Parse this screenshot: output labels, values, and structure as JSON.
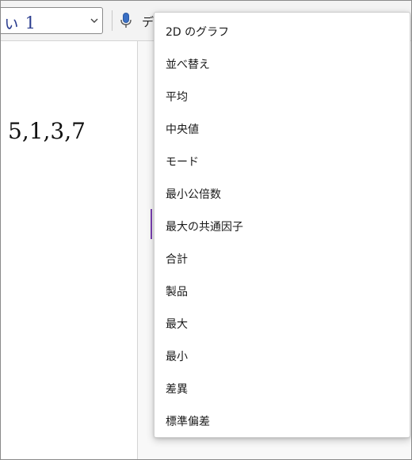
{
  "toolbar": {
    "style_value": "ぃ 1",
    "dictate_label": "デ"
  },
  "page": {
    "math_text": "5,1,3,7"
  },
  "menu": {
    "items": [
      {
        "label": "2D のグラフ"
      },
      {
        "label": "並べ替え"
      },
      {
        "label": "平均"
      },
      {
        "label": "中央値"
      },
      {
        "label": "モード"
      },
      {
        "label": "最小公倍数"
      },
      {
        "label": "最大の共通因子"
      },
      {
        "label": "合計"
      },
      {
        "label": "製品"
      },
      {
        "label": "最大"
      },
      {
        "label": "最小"
      },
      {
        "label": "差異"
      },
      {
        "label": "標準偏差"
      }
    ]
  },
  "colors": {
    "style_text": "#2b3d8f",
    "caret": "#7a3fb1",
    "mic_icon": "#3a6fc4"
  }
}
